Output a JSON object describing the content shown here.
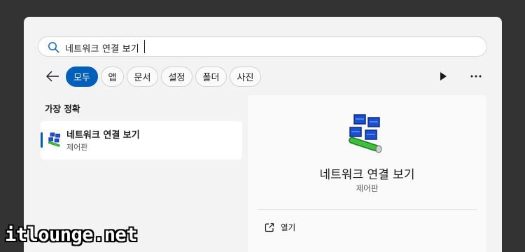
{
  "search": {
    "query": "네트워크 연결 보기"
  },
  "filters": {
    "back_icon": "arrow-left-icon",
    "items": [
      {
        "label": "모두",
        "active": true
      },
      {
        "label": "앱",
        "active": false
      },
      {
        "label": "문서",
        "active": false
      },
      {
        "label": "설정",
        "active": false
      },
      {
        "label": "폴더",
        "active": false
      },
      {
        "label": "사진",
        "active": false
      }
    ],
    "play_icon": "play-icon",
    "more_icon": "more-horizontal-icon"
  },
  "best_match": {
    "section_label": "가장 정확",
    "title": "네트워크 연결 보기",
    "subtitle": "제어판",
    "icon": "network-connections-icon"
  },
  "detail": {
    "title": "네트워크 연결 보기",
    "subtitle": "제어판",
    "icon": "network-connections-icon",
    "actions": [
      {
        "label": "열기",
        "icon": "open-external-icon"
      }
    ]
  },
  "watermark": "itlounge.net",
  "colors": {
    "accent": "#005fb8",
    "panel": "#f3f3f3",
    "backdrop": "#333333"
  }
}
